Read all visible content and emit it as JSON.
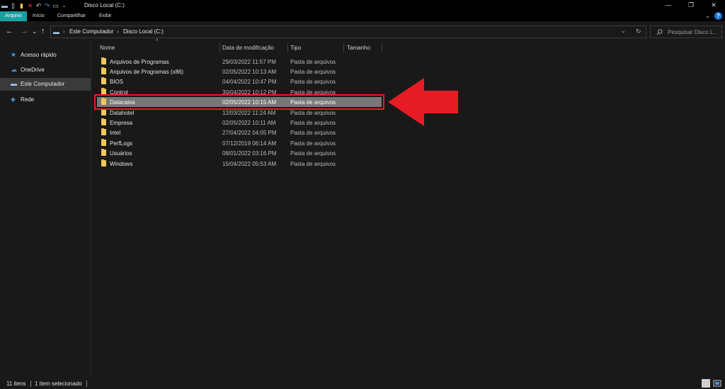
{
  "window": {
    "title": "Disco Local (C:)",
    "minimize": "—",
    "maximize": "❐",
    "close": "✕"
  },
  "ribbon": {
    "tabs": [
      "Arquivo",
      "Início",
      "Compartilhar",
      "Exibir"
    ],
    "help": "?"
  },
  "nav": {
    "back": "←",
    "forward": "→",
    "recent": "⌄",
    "up": "↑"
  },
  "address": {
    "crumbs": [
      "Este Computador",
      "Disco Local (C:)"
    ],
    "separator": "›"
  },
  "search": {
    "placeholder": "Pesquisar Disco L..."
  },
  "sidebar": {
    "items": [
      {
        "label": "Acesso rápido",
        "icon": "star-icon"
      },
      {
        "label": "OneDrive",
        "icon": "cloud-icon"
      },
      {
        "label": "Este Computador",
        "icon": "computer-icon"
      },
      {
        "label": "Rede",
        "icon": "network-icon"
      }
    ]
  },
  "columns": {
    "name": "Nome",
    "date": "Data de modificação",
    "type": "Tipo",
    "size": "Tamanho"
  },
  "files": [
    {
      "name": "Arquivos de Programas",
      "date": "29/03/2022 11:57 PM",
      "type": "Pasta de arquivos"
    },
    {
      "name": "Arquivos de Programas (x86)",
      "date": "02/05/2022 10:13 AM",
      "type": "Pasta de arquivos"
    },
    {
      "name": "BIOS",
      "date": "04/04/2022 10:47 PM",
      "type": "Pasta de arquivos"
    },
    {
      "name": "Control",
      "date": "30/04/2022 10:12 PM",
      "type": "Pasta de arquivos"
    },
    {
      "name": "Datacaixa",
      "date": "02/05/2022 10:15 AM",
      "type": "Pasta de arquivos",
      "selected": true
    },
    {
      "name": "Datahotel",
      "date": "12/03/2022 11:24 AM",
      "type": "Pasta de arquivos"
    },
    {
      "name": "Empresa",
      "date": "02/05/2022 10:11 AM",
      "type": "Pasta de arquivos"
    },
    {
      "name": "Intel",
      "date": "27/04/2022 04:05 PM",
      "type": "Pasta de arquivos"
    },
    {
      "name": "PerfLogs",
      "date": "07/12/2019 06:14 AM",
      "type": "Pasta de arquivos"
    },
    {
      "name": "Usuários",
      "date": "08/01/2022 03:16 PM",
      "type": "Pasta de arquivos"
    },
    {
      "name": "Windows",
      "date": "15/04/2022 05:53 AM",
      "type": "Pasta de arquivos"
    }
  ],
  "status": {
    "count": "11 itens",
    "selected": "1 item selecionado"
  },
  "colors": {
    "accent_file_tab": "#1aa0a0",
    "highlight": "#e51c23",
    "folder": "#f0c85b",
    "selected_row": "#777777"
  }
}
